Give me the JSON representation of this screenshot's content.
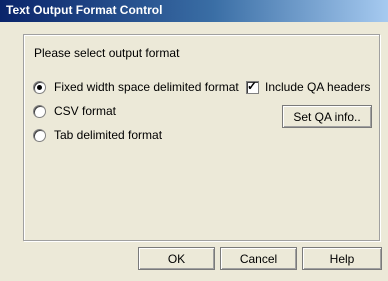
{
  "window": {
    "title": "Text Output Format Control"
  },
  "group": {
    "prompt": "Please select output format"
  },
  "options": [
    {
      "label": "Fixed width space delimited format",
      "selected": true
    },
    {
      "label": "CSV format",
      "selected": false
    },
    {
      "label": "Tab delimited format",
      "selected": false
    }
  ],
  "qa": {
    "checkbox_label": "Include QA headers",
    "checked": true,
    "set_button": "Set QA info.."
  },
  "buttons": {
    "ok": "OK",
    "cancel": "Cancel",
    "help": "Help"
  }
}
